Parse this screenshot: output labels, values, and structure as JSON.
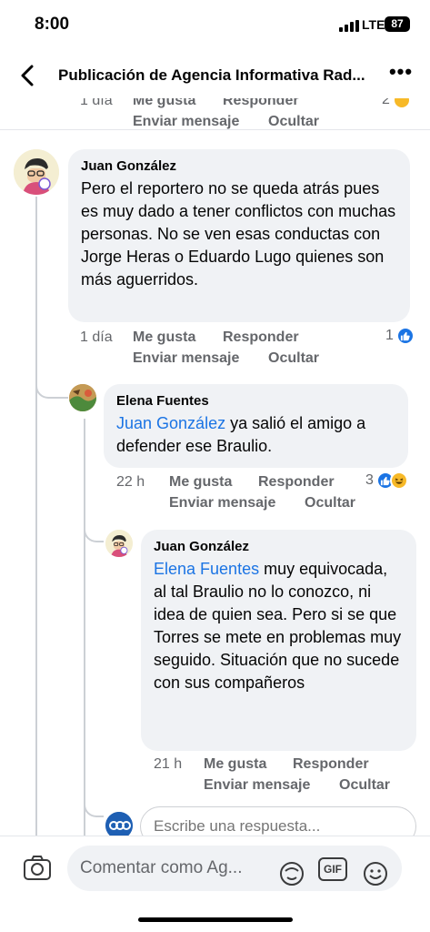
{
  "status_bar": {
    "time": "8:00",
    "network": "LTE",
    "battery": "87"
  },
  "nav": {
    "title": "Publicación de Agencia Informativa Rad...",
    "back_icon": "chevron-left-icon",
    "more_icon": "more-icon"
  },
  "top_actions": {
    "time": "1 día",
    "like": "Me gusta",
    "reply": "Responder",
    "message": "Enviar mensaje",
    "hide": "Ocultar",
    "reaction_count": "2"
  },
  "comments": [
    {
      "author": "Juan González",
      "text": "Pero el reportero no se queda atrás pues es muy dado a tener conflictos con muchas personas.  No se ven esas conductas con Jorge Heras o Eduardo Lugo quienes son más aguerridos.",
      "time": "1 día",
      "like": "Me gusta",
      "reply": "Responder",
      "message": "Enviar mensaje",
      "hide": "Ocultar",
      "reaction_count": "1"
    },
    {
      "author": "Elena Fuentes",
      "mention": "Juan González",
      "text": " ya salió el amigo a defender ese Braulio.",
      "time": "22 h",
      "like": "Me gusta",
      "reply": "Responder",
      "message": "Enviar mensaje",
      "hide": "Ocultar",
      "reaction_count": "3"
    },
    {
      "author": "Juan González",
      "mention": "Elena Fuentes",
      "text": " muy equivocada,  al tal Braulio no lo conozco, ni idea de quien sea. Pero si se que Torres se mete en problemas muy seguido.  Situación que no sucede con sus compañeros",
      "time": "21 h",
      "like": "Me gusta",
      "reply": "Responder",
      "message": "Enviar mensaje",
      "hide": "Ocultar"
    }
  ],
  "reply_input": {
    "placeholder": "Escribe una respuesta..."
  },
  "composer": {
    "placeholder": "Comentar como Ag...",
    "gif": "GIF"
  },
  "colors": {
    "link": "#1b74e4",
    "bubble": "#f0f2f5",
    "meta": "#65676b"
  }
}
